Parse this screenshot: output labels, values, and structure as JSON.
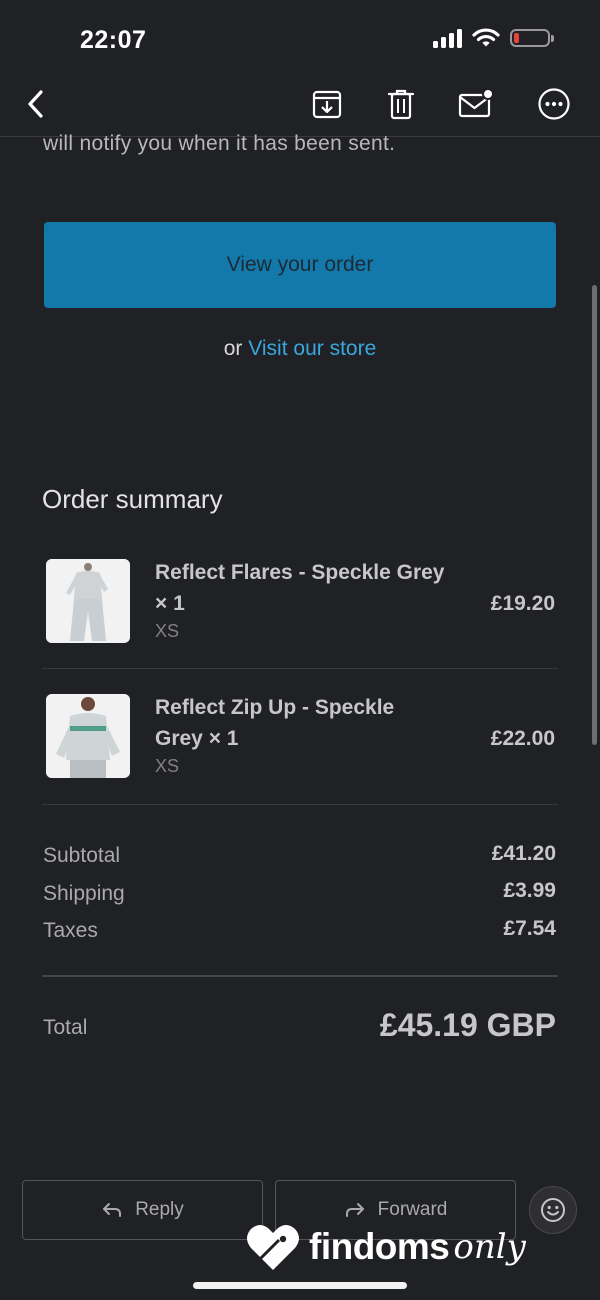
{
  "status_bar": {
    "time": "22:07"
  },
  "toolbar": {
    "icons": [
      "back-chevron-icon",
      "archive-icon",
      "trash-icon",
      "unread-mail-icon",
      "more-icon"
    ]
  },
  "email": {
    "partial_text": "will notify you when it has been sent.",
    "view_order_label": "View your order",
    "or_text": "or",
    "visit_store_label": "Visit our store",
    "order_summary_title": "Order summary",
    "items": [
      {
        "name": "Reflect Flares - Speckle Grey × 1",
        "variant": "XS",
        "price": "£19.20"
      },
      {
        "name": "Reflect Zip Up - Speckle Grey × 1",
        "variant": "XS",
        "price": "£22.00"
      }
    ],
    "totals": {
      "subtotal_label": "Subtotal",
      "subtotal_value": "£41.20",
      "shipping_label": "Shipping",
      "shipping_value": "£3.99",
      "taxes_label": "Taxes",
      "taxes_value": "£7.54",
      "total_label": "Total",
      "total_value": "£45.19 GBP"
    }
  },
  "bottom_bar": {
    "reply_label": "Reply",
    "forward_label": "Forward"
  },
  "watermark": {
    "brand": "findoms",
    "script": "only"
  },
  "colors": {
    "background": "#202124",
    "primary_button": "#1379ab",
    "link": "#39a6df",
    "battery_low": "#e5443f"
  }
}
